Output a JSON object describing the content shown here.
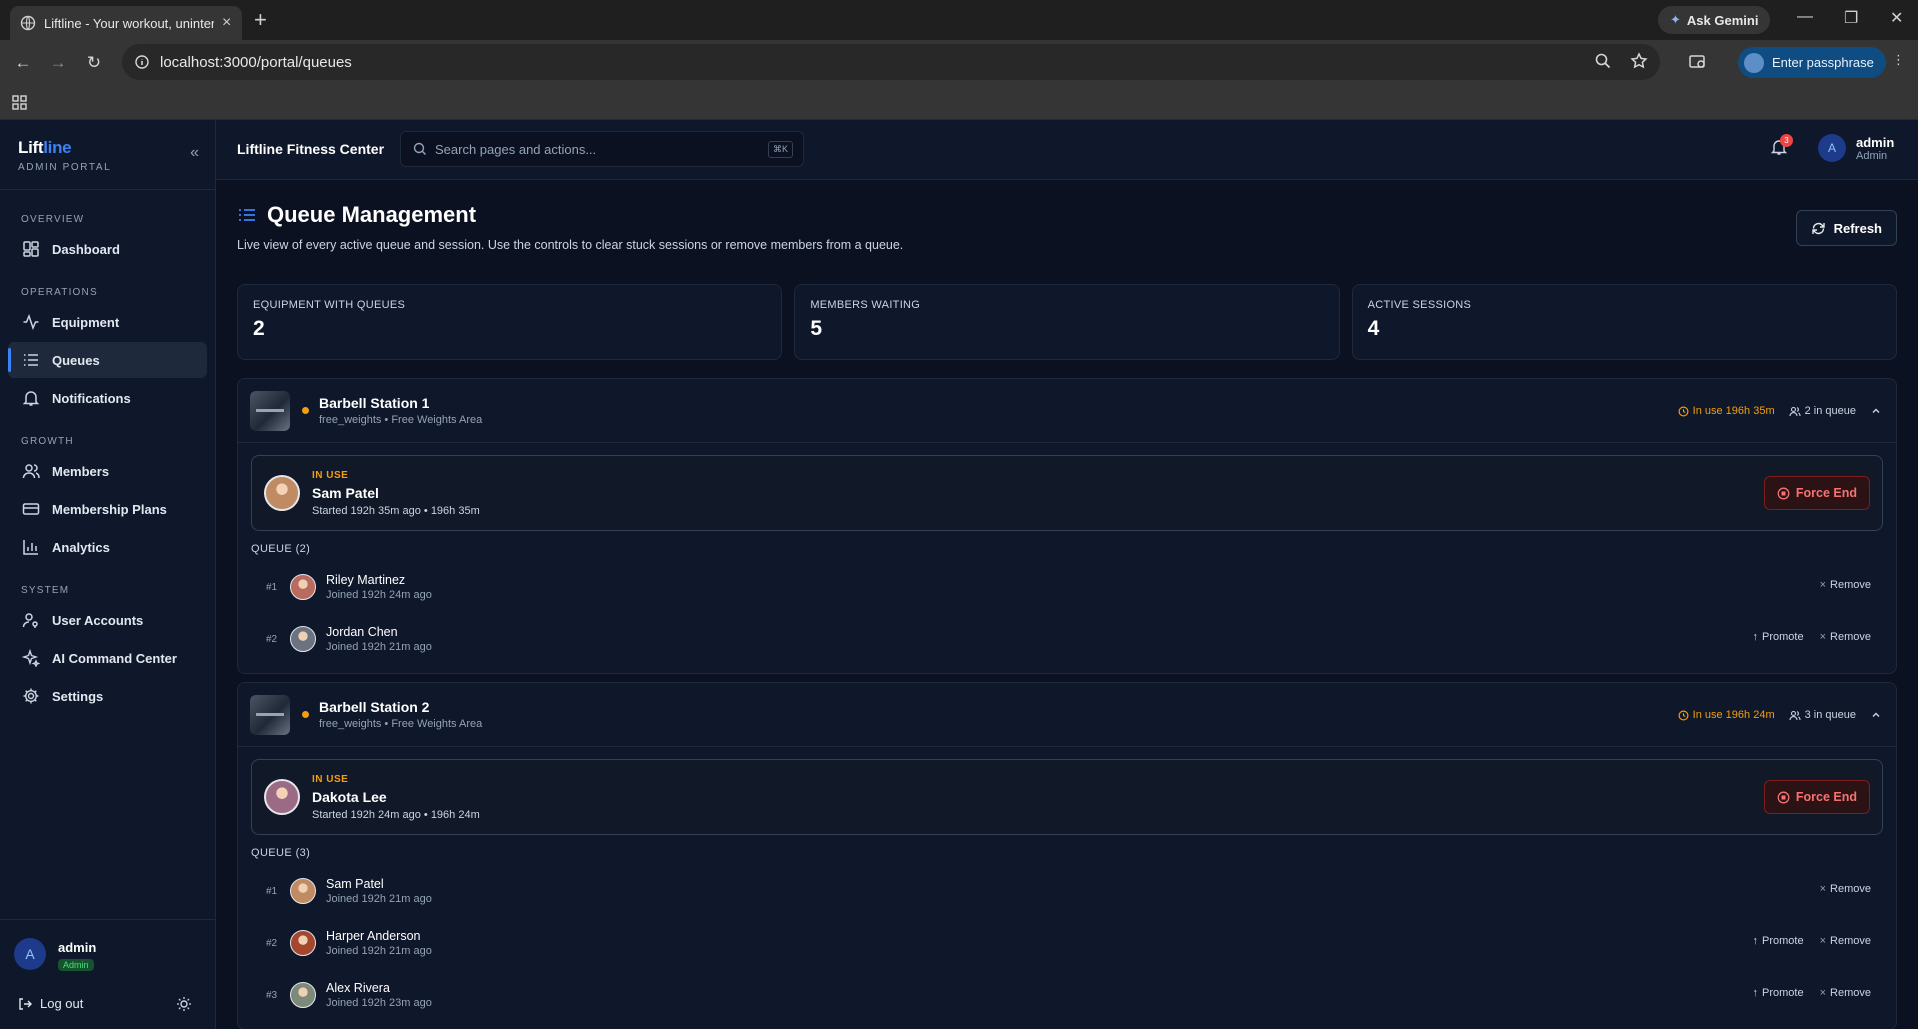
{
  "browser": {
    "tab_title": "Liftline - Your workout, uninterrupted",
    "url": "localhost:3000/portal/queues",
    "gemini_label": "Ask Gemini",
    "passphrase_label": "Enter passphrase"
  },
  "sidebar": {
    "brand_lift": "Lift",
    "brand_line": "line",
    "brand_sub": "ADMIN PORTAL",
    "sections": [
      {
        "label": "OVERVIEW",
        "items": [
          {
            "label": "Dashboard",
            "icon": "dashboard-icon"
          }
        ]
      },
      {
        "label": "OPERATIONS",
        "items": [
          {
            "label": "Equipment",
            "icon": "activity-icon"
          },
          {
            "label": "Queues",
            "icon": "list-icon",
            "active": true
          },
          {
            "label": "Notifications",
            "icon": "bell-icon"
          }
        ]
      },
      {
        "label": "GROWTH",
        "items": [
          {
            "label": "Members",
            "icon": "users-icon"
          },
          {
            "label": "Membership Plans",
            "icon": "card-icon"
          },
          {
            "label": "Analytics",
            "icon": "bar-chart-icon"
          }
        ]
      },
      {
        "label": "SYSTEM",
        "items": [
          {
            "label": "User Accounts",
            "icon": "user-key-icon"
          },
          {
            "label": "AI Command Center",
            "icon": "sparkles-icon"
          },
          {
            "label": "Settings",
            "icon": "gear-icon"
          }
        ]
      }
    ],
    "user": {
      "initial": "A",
      "name": "admin",
      "role": "Admin"
    },
    "logout_label": "Log out"
  },
  "topbar": {
    "org_name": "Liftline Fitness Center",
    "search_placeholder": "Search pages and actions...",
    "search_shortcut": "⌘K",
    "notification_count": "3",
    "user_initial": "A",
    "user_name": "admin",
    "user_role": "Admin"
  },
  "page": {
    "title": "Queue Management",
    "description": "Live view of every active queue and session. Use the controls to clear stuck sessions or remove members from a queue.",
    "refresh_label": "Refresh"
  },
  "stats": [
    {
      "label": "EQUIPMENT WITH QUEUES",
      "value": "2"
    },
    {
      "label": "MEMBERS WAITING",
      "value": "5"
    },
    {
      "label": "ACTIVE SESSIONS",
      "value": "4"
    }
  ],
  "equipment": [
    {
      "name": "Barbell Station 1",
      "meta": "free_weights • Free Weights Area",
      "in_use": "In use 196h 35m",
      "in_queue": "2 in queue",
      "session": {
        "tag": "IN USE",
        "name": "Sam Patel",
        "meta": "Started 192h 35m ago • 196h 35m",
        "avatar_color": "#c08a63"
      },
      "force_end_label": "Force End",
      "queue_label": "QUEUE (2)",
      "queue": [
        {
          "pos": "#1",
          "name": "Riley Martinez",
          "joined": "Joined 192h 24m ago",
          "promote": false,
          "avatar_color": "#b86b5e"
        },
        {
          "pos": "#2",
          "name": "Jordan Chen",
          "joined": "Joined 192h 21m ago",
          "promote": true,
          "avatar_color": "#6b7280"
        }
      ]
    },
    {
      "name": "Barbell Station 2",
      "meta": "free_weights • Free Weights Area",
      "in_use": "In use 196h 24m",
      "in_queue": "3 in queue",
      "session": {
        "tag": "IN USE",
        "name": "Dakota Lee",
        "meta": "Started 192h 24m ago • 196h 24m",
        "avatar_color": "#9b6b86"
      },
      "force_end_label": "Force End",
      "queue_label": "QUEUE (3)",
      "queue": [
        {
          "pos": "#1",
          "name": "Sam Patel",
          "joined": "Joined 192h 21m ago",
          "promote": false,
          "avatar_color": "#c08a63"
        },
        {
          "pos": "#2",
          "name": "Harper Anderson",
          "joined": "Joined 192h 21m ago",
          "promote": true,
          "avatar_color": "#a5462f"
        },
        {
          "pos": "#3",
          "name": "Alex Rivera",
          "joined": "Joined 192h 23m ago",
          "promote": true,
          "avatar_color": "#7c8a7a"
        }
      ]
    }
  ],
  "labels": {
    "promote": "Promote",
    "remove": "Remove"
  },
  "colors": {
    "accent": "#3b82f6",
    "in_use": "#f59e0b",
    "danger": "#f87171",
    "background": "#0b1120",
    "panel": "#0f172a"
  }
}
